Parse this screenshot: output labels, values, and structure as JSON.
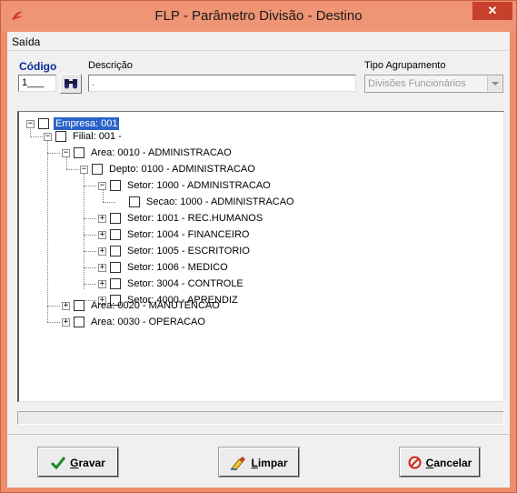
{
  "window": {
    "title": "FLP - Parâmetro Divisão - Destino"
  },
  "menu": {
    "items": [
      {
        "label": "Saída"
      }
    ]
  },
  "form": {
    "codigo_label": "Código",
    "codigo_value": "1___",
    "descricao_label": "Descrição",
    "descricao_value": ".",
    "tipo_label": "Tipo Agrupamento",
    "tipo_value": "Divisões Funcionários"
  },
  "tree": {
    "nodes": [
      {
        "label": "Empresa: 001",
        "selected": true,
        "expanded": true
      },
      {
        "label": "Filial: 001 -",
        "expanded": true
      },
      {
        "label": "Area: 0010 - ADMINISTRACAO",
        "expanded": true
      },
      {
        "label": "Depto: 0100 - ADMINISTRACAO",
        "expanded": true
      },
      {
        "label": "Setor: 1000 - ADMINISTRACAO",
        "expanded": true
      },
      {
        "label": "Secao: 1000 - ADMINISTRACAO"
      },
      {
        "label": "Setor: 1001 - REC.HUMANOS",
        "expanded": false
      },
      {
        "label": "Setor: 1004 - FINANCEIRO",
        "expanded": false
      },
      {
        "label": "Setor: 1005 - ESCRITORIO",
        "expanded": false
      },
      {
        "label": "Setor: 1006 - MEDICO",
        "expanded": false
      },
      {
        "label": "Setor: 3004 - CONTROLE",
        "expanded": false
      },
      {
        "label": "Setor: 4000 - APRENDIZ",
        "expanded": false
      },
      {
        "label": "Area: 0020 - MANUTENCAO",
        "expanded": false
      },
      {
        "label": "Area: 0030 - OPERACAO",
        "expanded": false
      }
    ]
  },
  "buttons": {
    "gravar": {
      "underlined": "G",
      "rest": "ravar"
    },
    "limpar": {
      "underlined": "L",
      "rest": "impar"
    },
    "cancelar": {
      "underlined": "C",
      "rest": "ancelar"
    }
  },
  "colors": {
    "titlebar": "#ef9474",
    "close": "#c7402a",
    "selection": "#2a63c8",
    "codigo_label": "#0a2a99"
  }
}
